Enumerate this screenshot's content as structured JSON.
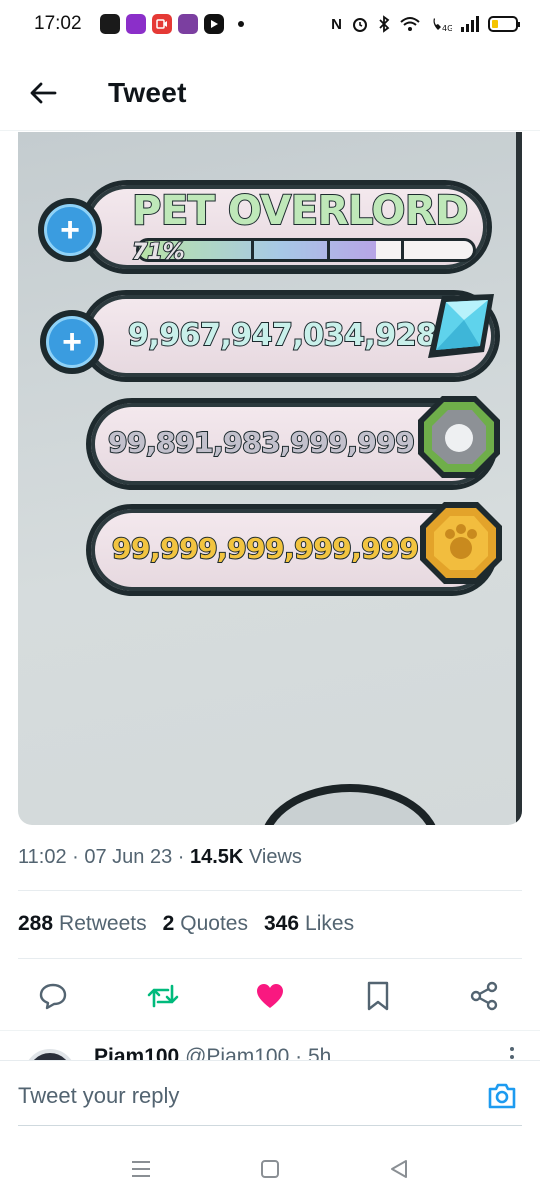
{
  "status": {
    "time": "17:02",
    "apps": [
      {
        "icon": "play-club-icon",
        "label": "PLAY",
        "color": "#1a1a1a"
      },
      {
        "icon": "slots-icon",
        "label": "SLOTS",
        "color": "#8b2fc9"
      },
      {
        "icon": "recorder-icon",
        "label": "",
        "color": "#e53935"
      },
      {
        "icon": "slots-game-icon",
        "label": "SLOTS",
        "color": "#7b3fa0"
      },
      {
        "icon": "youtube-icon",
        "label": "",
        "color": "#111111"
      }
    ]
  },
  "header": {
    "title": "Tweet"
  },
  "image": {
    "title_banner": "PET OVERLORD",
    "progress_label": "71%",
    "progress_value": 0.71,
    "diamonds": "9,967,947,034,928",
    "gems": "99,891,983,999,999",
    "coins": "99,999,999,999,999"
  },
  "meta": {
    "time": "11:02",
    "date": "07 Jun 23",
    "views_count": "14.5K",
    "views_label": "Views"
  },
  "stats": {
    "retweets_count": "288",
    "retweets_label": "Retweets",
    "quotes_count": "2",
    "quotes_label": "Quotes",
    "likes_count": "346",
    "likes_label": "Likes"
  },
  "reply_preview": {
    "name": "Piam100",
    "handle": "@Piam100",
    "age": "· 5h"
  },
  "reply": {
    "placeholder": "Tweet your reply"
  },
  "colors": {
    "retweet": "#00ba7c",
    "like": "#f91880",
    "link": "#1d9bf0",
    "muted": "#536471"
  }
}
